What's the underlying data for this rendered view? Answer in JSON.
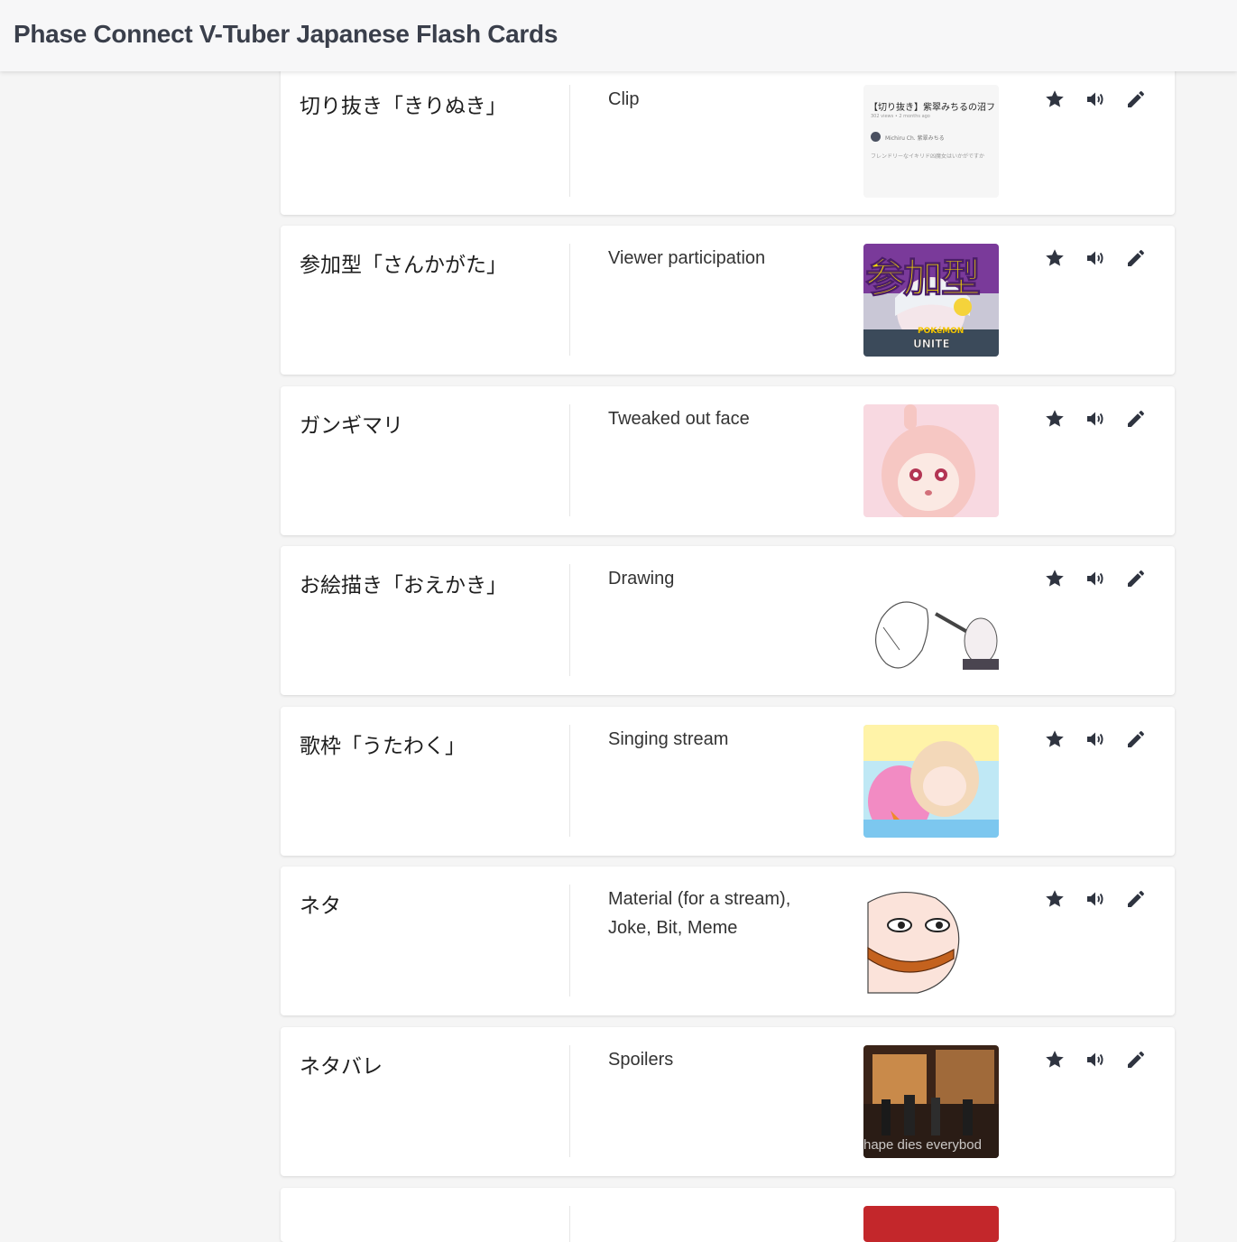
{
  "app": {
    "title": "Phase Connect V-Tuber Japanese Flash Cards"
  },
  "cards": [
    {
      "term": "切り抜き「きりぬき」",
      "meaning": "Clip",
      "thumb": {
        "title": "【切り抜き】紫翠みちるの沼フ",
        "meta": "302 views • 2 months ago",
        "channel": "Michiru Ch. 紫翠みちる",
        "desc": "フレンドリーなイキリド凶魔女はいかがですか"
      }
    },
    {
      "term": "参加型「さんかがた」",
      "meaning": "Viewer participation",
      "thumb": {
        "title": "参加型",
        "badge": "POKéMON",
        "badge2": "UNITE"
      }
    },
    {
      "term": "ガンギマリ",
      "meaning": "Tweaked out face",
      "thumb": {}
    },
    {
      "term": "お絵描き「おえかき」",
      "meaning": "Drawing",
      "thumb": {}
    },
    {
      "term": "歌枠「うたわく」",
      "meaning": "Singing stream",
      "thumb": {}
    },
    {
      "term": "ネタ",
      "meaning": "Material (for a stream), Joke, Bit, Meme",
      "thumb": {}
    },
    {
      "term": "ネタバレ",
      "meaning": "Spoilers",
      "thumb": {
        "caption": "hape dies everybod"
      }
    }
  ],
  "icons": {
    "favorite": "star-icon",
    "audio": "volume-icon",
    "edit": "pencil-icon"
  },
  "colors": {
    "icon": "#2f3440",
    "header_bg": "#f7f7f8",
    "page_bg": "#f5f5f5",
    "title": "#3a3f4b"
  }
}
